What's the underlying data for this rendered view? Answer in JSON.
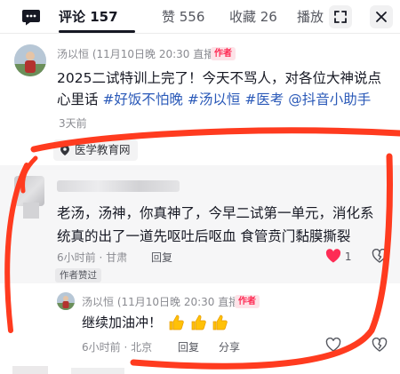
{
  "header": {
    "tabs": [
      {
        "label": "评论 157",
        "active": true
      },
      {
        "label": "赞 556",
        "active": false
      },
      {
        "label": "收藏 26",
        "active": false
      },
      {
        "label": "播放",
        "active": false
      }
    ],
    "icons": [
      "message-icon",
      "fullscreen-icon",
      "close-icon"
    ]
  },
  "post": {
    "username": "汤以恒 (11月10日晚 20:30 直播)",
    "badge": "作者",
    "text_plain": "2025二试特训上完了！今天不骂人，对各位大神说点心里话 ",
    "hashtags": [
      "#好饭不怕晚",
      "#汤以恒",
      "#医考",
      "@抖音小助手"
    ],
    "time": "3天前",
    "location": "医学教育网"
  },
  "reply1": {
    "text": "老汤，汤神，你真神了，今早二试第一单元，消化系统真的出了一道先呕吐后呕血 食管贲门黏膜撕裂",
    "time_location": "6小时前 · 甘肃",
    "reply_label": "回复",
    "like_count": "1",
    "liked_tag": "作者赞过"
  },
  "reply2": {
    "username": "汤以恒 (11月10日晚 20:30 直播)",
    "badge": "作者",
    "text": "继续加油冲！",
    "time_location": "6小时前 · 北京",
    "reply_label": "回复",
    "share_label": "分享"
  },
  "colors": {
    "accent": "#fe2c55",
    "hashtag": "#2a59b8",
    "annotation": "#ff3b1f"
  }
}
